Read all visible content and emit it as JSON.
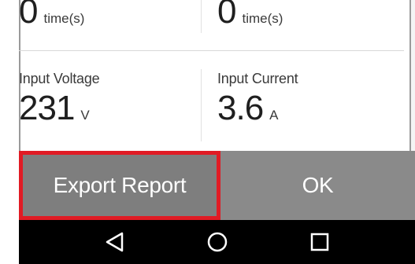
{
  "stats": {
    "top_left": {
      "value": "0",
      "unit": "time(s)"
    },
    "top_right": {
      "value": "0",
      "unit": "time(s)"
    },
    "input_voltage": {
      "label": "Input Voltage",
      "value": "231",
      "unit": "V"
    },
    "input_current": {
      "label": "Input Current",
      "value": "3.6",
      "unit": "A"
    }
  },
  "actions": {
    "export_label": "Export Report",
    "ok_label": "OK",
    "highlight_color": "#e01b24"
  },
  "navigation": {
    "back_icon": "back-triangle-icon",
    "home_icon": "home-circle-icon",
    "recent_icon": "recent-apps-square-icon"
  }
}
